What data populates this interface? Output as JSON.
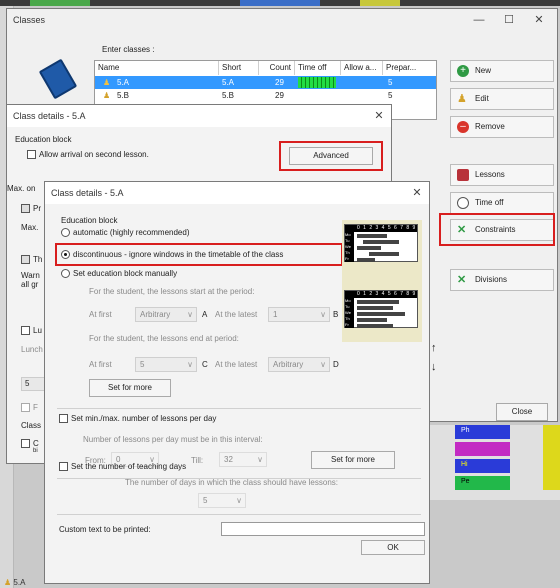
{
  "classes_window": {
    "title": "Classes",
    "enter_label": "Enter classes :",
    "columns": [
      "Name",
      "Short",
      "Count",
      "Time off",
      "Allow a...",
      "Prepar..."
    ],
    "rows": [
      {
        "name": "5.A",
        "short": "5.A",
        "count": "29",
        "prepar": "5"
      },
      {
        "name": "5.B",
        "short": "5.B",
        "count": "29",
        "prepar": "5"
      }
    ],
    "buttons": {
      "new": "New",
      "edit": "Edit",
      "remove": "Remove",
      "lessons": "Lessons",
      "time_off": "Time off",
      "constraints": "Constraints",
      "divisions": "Divisions",
      "close": "Close"
    },
    "bottom_item": "5.A"
  },
  "details_back": {
    "title": "Class details - 5.A",
    "education_block_label": "Education block",
    "allow_arrival_label": "Allow arrival on second lesson.",
    "advanced_button": "Advanced",
    "max_label": "Max. on",
    "max2_label": "Max.",
    "pr_label": "Pr",
    "th_label": "Th",
    "warn_label": "Warn",
    "allgr_label": "all gr",
    "lu_label": "Lu",
    "lunch_label": "Lunch",
    "five_value": "5",
    "f_label": "F",
    "class_label": "Class",
    "c_label": "C",
    "b_label": "bi"
  },
  "details_front": {
    "title": "Class details - 5.A",
    "education_block_label": "Education block",
    "options": {
      "automatic": "automatic (highly recommended)",
      "discontinuous": "discontinuous - ignore windows in the timetable of the class",
      "manual": "Set education block manually"
    },
    "start_text": "For the student, the lessons start at the period:",
    "end_text": "For the student, the lessons end at period:",
    "at_first": "At first",
    "at_latest": "At the latest",
    "start_first_value": "Arbitrary",
    "start_latest_value": "1",
    "end_first_value": "5",
    "end_latest_value": "Arbitrary",
    "letter_a": "A",
    "letter_b": "B",
    "letter_c": "C",
    "letter_d": "D",
    "set_for_more": "Set for more",
    "minmax_label": "Set min./max. number of lessons per day",
    "lessons_interval_text": "Number of lessons per day must be in this interval:",
    "from_label": "From:",
    "from_value": "0",
    "till_label": "Till:",
    "till_value": "32",
    "set_for_more2": "Set for more",
    "teaching_days_label": "Set the number of teaching days",
    "teaching_days_text": "The number of days in which the class should have lessons:",
    "teaching_days_value": "5",
    "custom_text_label": "Custom text to be printed:",
    "custom_text_value": "",
    "ok_button": "OK",
    "grid_header": "0 1 2 3 4 5 6 7 8 9 10",
    "grid_days": [
      "Mo",
      "Tu",
      "We",
      "Th",
      "Fr"
    ]
  },
  "timetable_cells": [
    "Ph",
    "Hi",
    "Pe",
    "Ma"
  ],
  "colors": {
    "highlight_red": "#d81e1e",
    "selection_blue": "#3399ff",
    "green_grid": "#22dd44"
  }
}
